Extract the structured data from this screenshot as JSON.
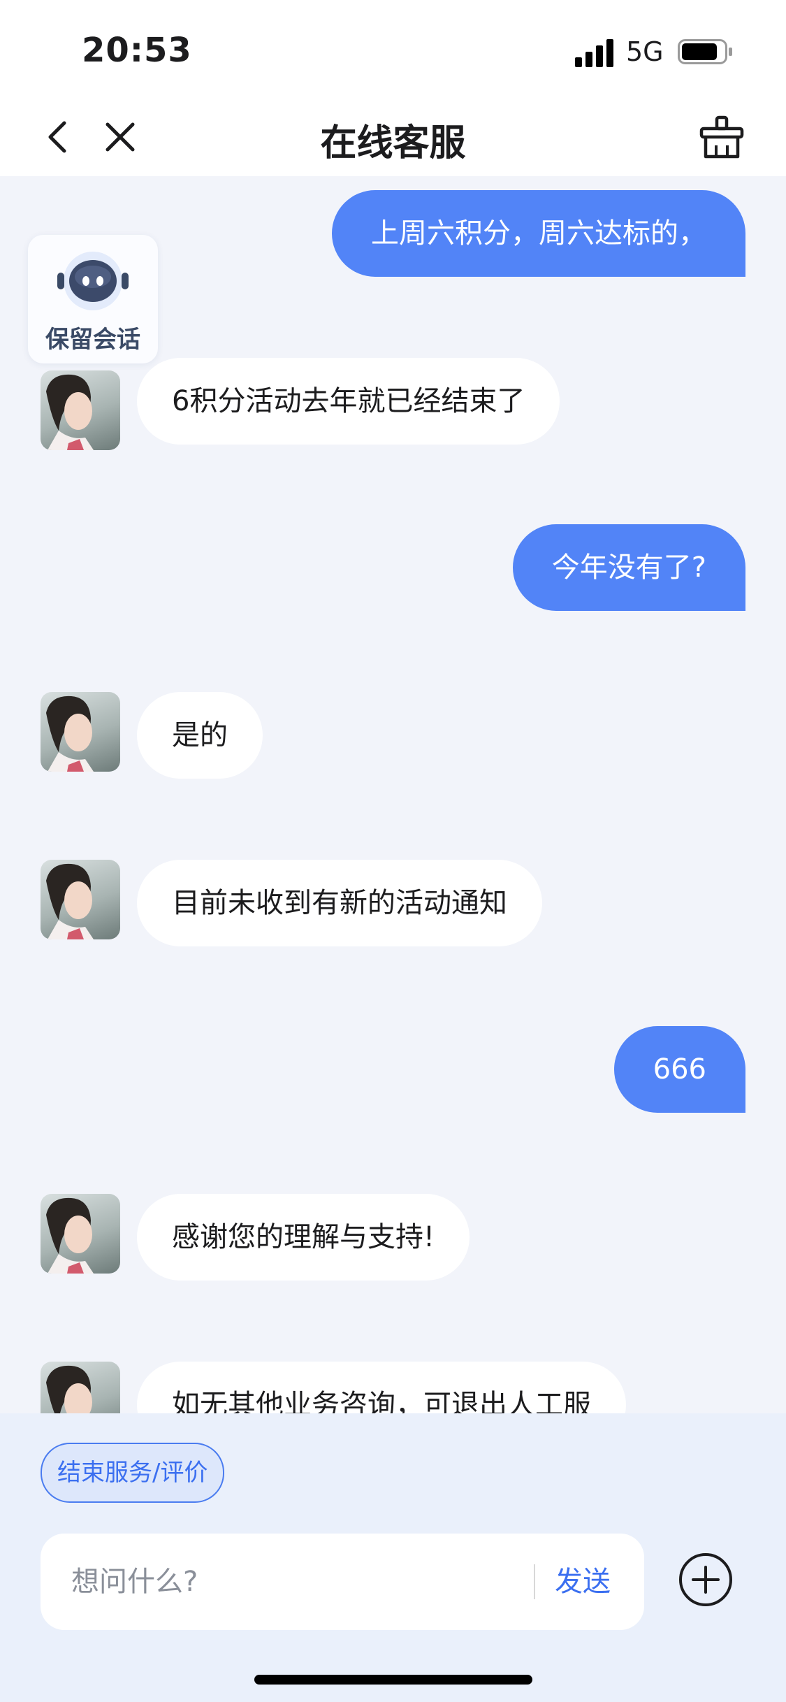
{
  "status_bar": {
    "time": "20:53",
    "network": "5G"
  },
  "nav": {
    "title": "在线客服"
  },
  "keep_session": {
    "label": "保留会话"
  },
  "messages": [
    {
      "from": "user",
      "text": "上周六积分，周六达标的，"
    },
    {
      "from": "agent",
      "text": "6积分活动去年就已经结束了"
    },
    {
      "from": "user",
      "text": "今年没有了?"
    },
    {
      "from": "agent",
      "text": "是的"
    },
    {
      "from": "agent",
      "text": "目前未收到有新的活动通知"
    },
    {
      "from": "user",
      "text": "666"
    },
    {
      "from": "agent",
      "text": "感谢您的理解与支持!"
    },
    {
      "from": "agent",
      "text": "如无其他业务咨询，可退出人工服"
    }
  ],
  "quick_action": {
    "label": "结束服务/评价"
  },
  "composer": {
    "placeholder": "想问什么?",
    "send_label": "发送"
  },
  "colors": {
    "accent": "#5284f7",
    "background": "#f2f4fa"
  }
}
